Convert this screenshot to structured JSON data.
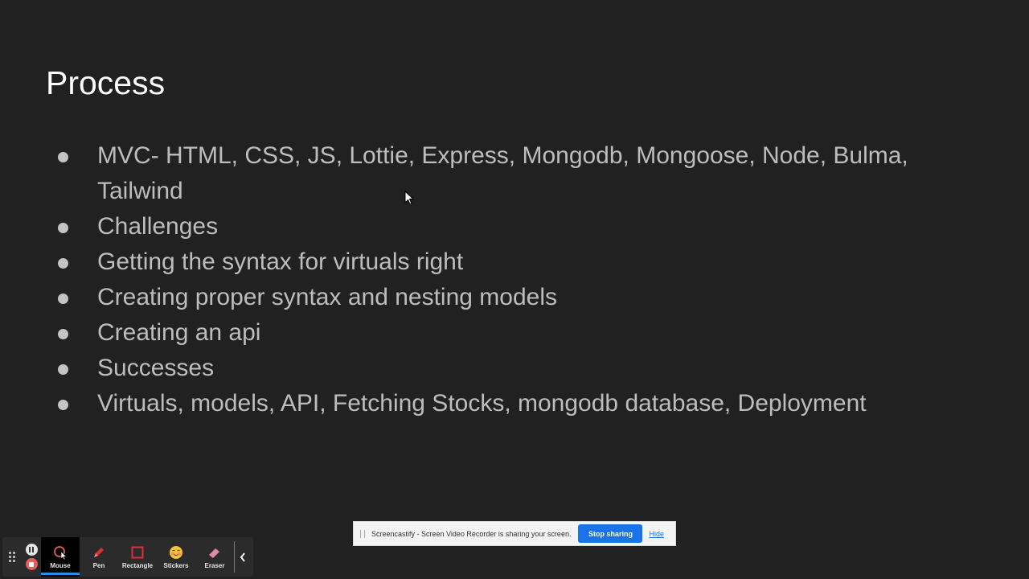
{
  "slide": {
    "title": "Process",
    "bullets": [
      "MVC- HTML, CSS, JS, Lottie, Express, Mongodb, Mongoose, Node, Bulma, Tailwind",
      "Challenges",
      "Getting the syntax for virtuals right",
      "Creating proper syntax and nesting models",
      "Creating an api",
      "Successes",
      "Virtuals, models, API, Fetching Stocks, mongodb database, Deployment"
    ]
  },
  "toolbar": {
    "tools": [
      {
        "label": "Mouse",
        "icon": "mouse-pointer-icon",
        "active": true
      },
      {
        "label": "Pen",
        "icon": "pen-icon",
        "active": false
      },
      {
        "label": "Rectangle",
        "icon": "rectangle-icon",
        "active": false
      },
      {
        "label": "Stickers",
        "icon": "sticker-smiley-icon",
        "active": false
      },
      {
        "label": "Eraser",
        "icon": "eraser-icon",
        "active": false
      }
    ],
    "active_color": "#2b8ce0"
  },
  "share_bar": {
    "message": "Screencastify - Screen Video Recorder is sharing your screen.",
    "stop_label": "Stop sharing",
    "hide_label": "Hide",
    "accent": "#1a73e8"
  }
}
